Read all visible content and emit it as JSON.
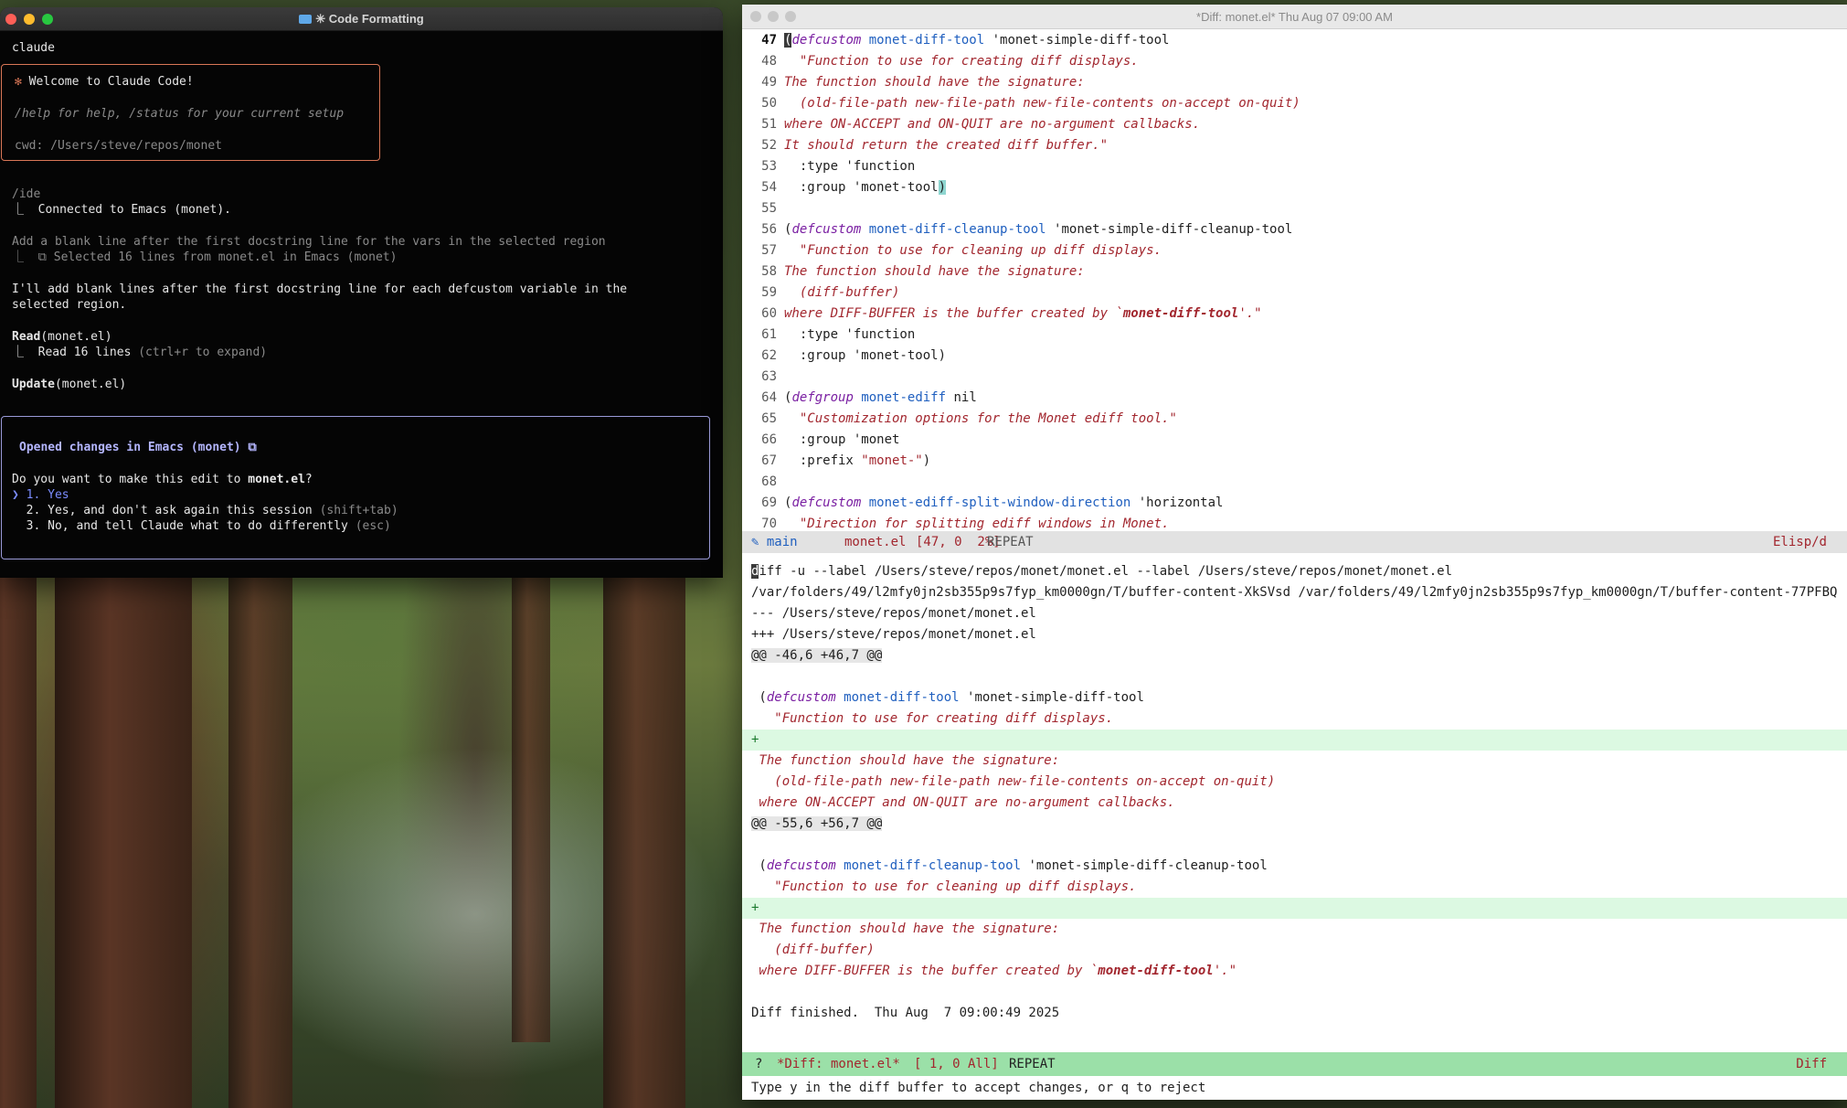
{
  "terminal": {
    "title": "✳ Code Formatting",
    "lines": {
      "claude": "claude",
      "welcome": "✻ Welcome to Claude Code!",
      "help": "/help for help, /status for your current setup",
      "cwd": "cwd: /Users/steve/repos/monet",
      "ide_cmd": "/ide",
      "connected": "⎿  Connected to Emacs (monet).",
      "user_prompt": "Add a blank line after the first docstring line for the vars in the selected region",
      "selected": "⎿  ⧉ Selected 16 lines from monet.el in Emacs (monet)",
      "reply1": "I'll add blank lines after the first docstring line for each defcustom variable in the",
      "reply2": "selected region.",
      "read_cmd": "Read",
      "read_arg": "(monet.el)",
      "read_result": "⎿  Read 16 lines",
      "read_hint": " (ctrl+r to expand)",
      "update_cmd": "Update",
      "update_arg": "(monet.el)"
    },
    "dialog": {
      "title": "Opened changes in Emacs (monet) ⧉",
      "question_prefix": "Do you want to make this edit to ",
      "question_file": "monet.el",
      "question_suffix": "?",
      "options": [
        "1. Yes",
        "2. Yes, and don't ask again this session ",
        "3. No, and tell Claude what to do differently "
      ],
      "option2_hint": "(shift+tab)",
      "option3_hint": "(esc)"
    }
  },
  "emacs": {
    "title": "*Diff: monet.el*   Thu Aug 07 09:00 AM",
    "code_lines": [
      {
        "n": "47",
        "parts": [
          [
            "cursor",
            "("
          ],
          [
            "kw",
            "defcustom"
          ],
          [
            "t",
            " "
          ],
          [
            "fn",
            "monet-diff-tool"
          ],
          [
            "t",
            " 'monet-simple-diff-tool"
          ]
        ]
      },
      {
        "n": "48",
        "parts": [
          [
            "str",
            "  \"Function to use for creating diff displays."
          ]
        ]
      },
      {
        "n": "49",
        "parts": [
          [
            "str",
            "The function should have the signature:"
          ]
        ]
      },
      {
        "n": "50",
        "parts": [
          [
            "str",
            "  (old-file-path new-file-path new-file-contents on-accept on-quit)"
          ]
        ]
      },
      {
        "n": "51",
        "parts": [
          [
            "str",
            "where ON-ACCEPT and ON-QUIT are no-argument callbacks."
          ]
        ]
      },
      {
        "n": "52",
        "parts": [
          [
            "str",
            "It should return the created diff buffer.\""
          ]
        ]
      },
      {
        "n": "53",
        "parts": [
          [
            "t",
            "  :type 'function"
          ]
        ]
      },
      {
        "n": "54",
        "parts": [
          [
            "t",
            "  :group 'monet-tool"
          ],
          [
            "paren",
            ")"
          ]
        ]
      },
      {
        "n": "55",
        "parts": [
          [
            "t",
            ""
          ]
        ]
      },
      {
        "n": "56",
        "parts": [
          [
            "t",
            "("
          ],
          [
            "kw",
            "defcustom"
          ],
          [
            "t",
            " "
          ],
          [
            "fn",
            "monet-diff-cleanup-tool"
          ],
          [
            "t",
            " 'monet-simple-diff-cleanup-tool"
          ]
        ]
      },
      {
        "n": "57",
        "parts": [
          [
            "str",
            "  \"Function to use for cleaning up diff displays."
          ]
        ]
      },
      {
        "n": "58",
        "parts": [
          [
            "str",
            "The function should have the signature:"
          ]
        ]
      },
      {
        "n": "59",
        "parts": [
          [
            "str",
            "  (diff-buffer)"
          ]
        ]
      },
      {
        "n": "60",
        "parts": [
          [
            "str",
            "where DIFF-BUFFER is the buffer created by `"
          ],
          [
            "qb",
            "monet-diff-tool"
          ],
          [
            "str",
            "'.\""
          ]
        ]
      },
      {
        "n": "61",
        "parts": [
          [
            "t",
            "  :type 'function"
          ]
        ]
      },
      {
        "n": "62",
        "parts": [
          [
            "t",
            "  :group 'monet-tool)"
          ]
        ]
      },
      {
        "n": "63",
        "parts": [
          [
            "t",
            ""
          ]
        ]
      },
      {
        "n": "64",
        "parts": [
          [
            "t",
            "("
          ],
          [
            "kw",
            "defgroup"
          ],
          [
            "t",
            " "
          ],
          [
            "fn",
            "monet-ediff"
          ],
          [
            "t",
            " nil"
          ]
        ]
      },
      {
        "n": "65",
        "parts": [
          [
            "str",
            "  \"Customization options for the Monet ediff tool.\""
          ]
        ]
      },
      {
        "n": "66",
        "parts": [
          [
            "t",
            "  :group 'monet"
          ]
        ]
      },
      {
        "n": "67",
        "parts": [
          [
            "t",
            "  :prefix "
          ],
          [
            "q",
            "\"monet-\""
          ],
          [
            "t",
            ")"
          ]
        ]
      },
      {
        "n": "68",
        "parts": [
          [
            "t",
            ""
          ]
        ]
      },
      {
        "n": "69",
        "parts": [
          [
            "t",
            "("
          ],
          [
            "kw",
            "defcustom"
          ],
          [
            "t",
            " "
          ],
          [
            "fn",
            "monet-ediff-split-window-direction"
          ],
          [
            "t",
            " 'horizontal"
          ]
        ]
      },
      {
        "n": "70",
        "parts": [
          [
            "str",
            "  \"Direction for splitting ediff windows in Monet."
          ]
        ]
      }
    ],
    "modeline1": {
      "branch": "✎ main",
      "file": "monet.el",
      "pos": "[47, 0  2%]",
      "repeat": "REPEAT",
      "mode": "Elisp/d"
    },
    "diff_lines": [
      {
        "k": "t",
        "parts": [
          [
            "cursor",
            "d"
          ],
          [
            "t",
            "iff -u --label /Users/steve/repos/monet/monet.el --label /Users/steve/repos/monet/monet.el"
          ]
        ]
      },
      {
        "k": "t",
        "parts": [
          [
            "t",
            "/var/folders/49/l2mfy0jn2sb355p9s7fyp_km0000gn/T/buffer-content-XkSVsd /var/folders/49/l2mfy0jn2sb355p9s7fyp_km0000gn/T/buffer-content-77PFBQ"
          ]
        ]
      },
      {
        "k": "t",
        "parts": [
          [
            "t",
            "--- /Users/steve/repos/monet/monet.el"
          ]
        ]
      },
      {
        "k": "t",
        "parts": [
          [
            "t",
            "+++ /Users/steve/repos/monet/monet.el"
          ]
        ]
      },
      {
        "k": "h",
        "parts": [
          [
            "hunk",
            "@@ -46,6 +46,7 @@"
          ]
        ]
      },
      {
        "k": "t",
        "parts": [
          [
            "t",
            ""
          ]
        ]
      },
      {
        "k": "t",
        "parts": [
          [
            "t",
            " ("
          ],
          [
            "kw",
            "defcustom"
          ],
          [
            "t",
            " "
          ],
          [
            "fn",
            "monet-diff-tool"
          ],
          [
            "t",
            " 'monet-simple-diff-tool"
          ]
        ]
      },
      {
        "k": "t",
        "parts": [
          [
            "str",
            "   \"Function to use for creating diff displays."
          ]
        ]
      },
      {
        "k": "a",
        "parts": [
          [
            "plus",
            "+"
          ]
        ]
      },
      {
        "k": "t",
        "parts": [
          [
            "str",
            " The function should have the signature:"
          ]
        ]
      },
      {
        "k": "t",
        "parts": [
          [
            "str",
            "   (old-file-path new-file-path new-file-contents on-accept on-quit)"
          ]
        ]
      },
      {
        "k": "t",
        "parts": [
          [
            "str",
            " where ON-ACCEPT and ON-QUIT are no-argument callbacks."
          ]
        ]
      },
      {
        "k": "h",
        "parts": [
          [
            "hunk",
            "@@ -55,6 +56,7 @@"
          ]
        ]
      },
      {
        "k": "t",
        "parts": [
          [
            "t",
            ""
          ]
        ]
      },
      {
        "k": "t",
        "parts": [
          [
            "t",
            " ("
          ],
          [
            "kw",
            "defcustom"
          ],
          [
            "t",
            " "
          ],
          [
            "fn",
            "monet-diff-cleanup-tool"
          ],
          [
            "t",
            " 'monet-simple-diff-cleanup-tool"
          ]
        ]
      },
      {
        "k": "t",
        "parts": [
          [
            "str",
            "   \"Function to use for cleaning up diff displays."
          ]
        ]
      },
      {
        "k": "a",
        "parts": [
          [
            "plus",
            "+"
          ]
        ]
      },
      {
        "k": "t",
        "parts": [
          [
            "str",
            " The function should have the signature:"
          ]
        ]
      },
      {
        "k": "t",
        "parts": [
          [
            "str",
            "   (diff-buffer)"
          ]
        ]
      },
      {
        "k": "t",
        "parts": [
          [
            "str",
            " where DIFF-BUFFER is the buffer created by `"
          ],
          [
            "qb",
            "monet-diff-tool"
          ],
          [
            "str",
            "'.\""
          ]
        ]
      },
      {
        "k": "t",
        "parts": [
          [
            "t",
            ""
          ]
        ]
      },
      {
        "k": "t",
        "parts": [
          [
            "t",
            "Diff finished.  Thu Aug  7 09:00:49 2025"
          ]
        ]
      }
    ],
    "modeline2": {
      "flag": "?",
      "buffer": "*Diff: monet.el*",
      "pos": "[ 1, 0 All]",
      "repeat": "REPEAT",
      "mode": "Diff"
    },
    "echo": "Type y in the diff buffer to accept changes, or q to reject"
  }
}
